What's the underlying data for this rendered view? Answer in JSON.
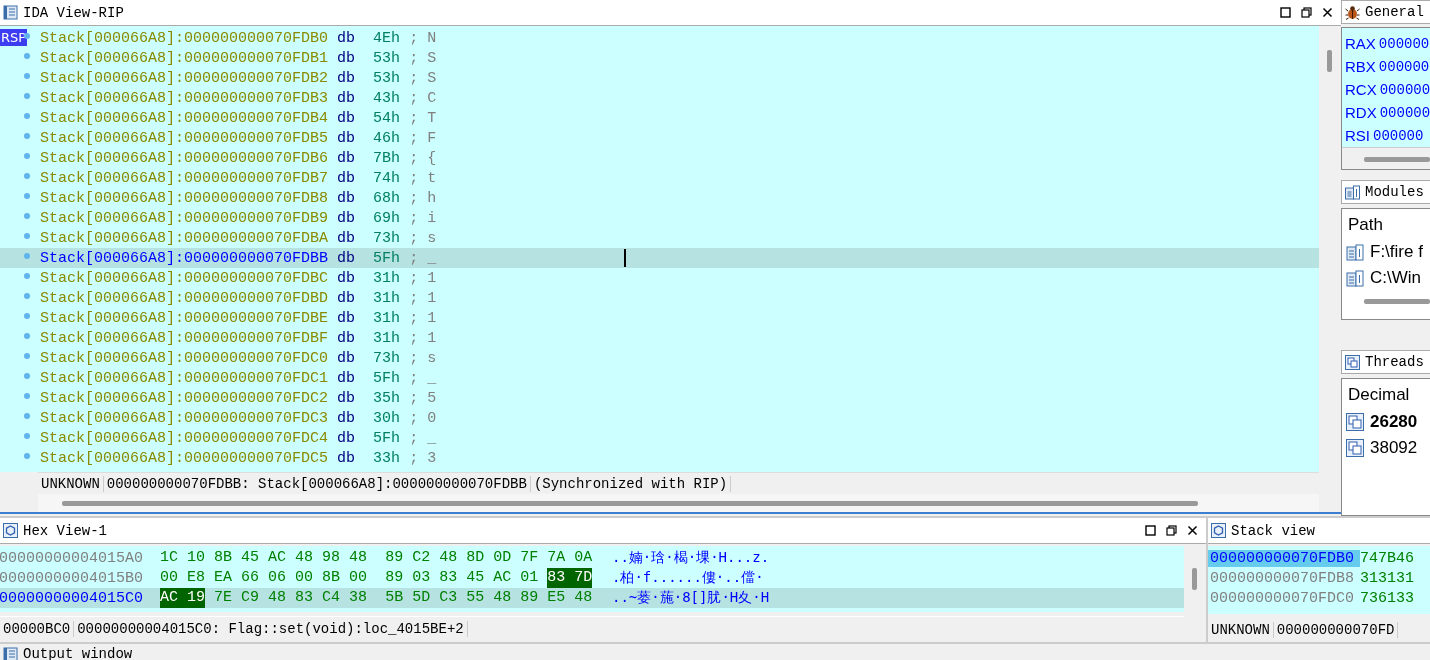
{
  "ida_view": {
    "title": "IDA View-RIP",
    "rows": [
      {
        "label": "RSP",
        "address": "Stack[000066A8]:000000000070FDB0",
        "directive": "db",
        "value": "4Eh",
        "comment": "; N",
        "selected": false
      },
      {
        "address": "Stack[000066A8]:000000000070FDB1",
        "directive": "db",
        "value": "53h",
        "comment": "; S",
        "selected": false
      },
      {
        "address": "Stack[000066A8]:000000000070FDB2",
        "directive": "db",
        "value": "53h",
        "comment": "; S",
        "selected": false
      },
      {
        "address": "Stack[000066A8]:000000000070FDB3",
        "directive": "db",
        "value": "43h",
        "comment": "; C",
        "selected": false
      },
      {
        "address": "Stack[000066A8]:000000000070FDB4",
        "directive": "db",
        "value": "54h",
        "comment": "; T",
        "selected": false
      },
      {
        "address": "Stack[000066A8]:000000000070FDB5",
        "directive": "db",
        "value": "46h",
        "comment": "; F",
        "selected": false
      },
      {
        "address": "Stack[000066A8]:000000000070FDB6",
        "directive": "db",
        "value": "7Bh",
        "comment": "; {",
        "selected": false
      },
      {
        "address": "Stack[000066A8]:000000000070FDB7",
        "directive": "db",
        "value": "74h",
        "comment": "; t",
        "selected": false
      },
      {
        "address": "Stack[000066A8]:000000000070FDB8",
        "directive": "db",
        "value": "68h",
        "comment": "; h",
        "selected": false
      },
      {
        "address": "Stack[000066A8]:000000000070FDB9",
        "directive": "db",
        "value": "69h",
        "comment": "; i",
        "selected": false
      },
      {
        "address": "Stack[000066A8]:000000000070FDBA",
        "directive": "db",
        "value": "73h",
        "comment": "; s",
        "selected": false
      },
      {
        "address": "Stack[000066A8]:000000000070FDBB",
        "directive": "db",
        "value": "5Fh",
        "comment": "; _",
        "selected": true
      },
      {
        "address": "Stack[000066A8]:000000000070FDBC",
        "directive": "db",
        "value": "31h",
        "comment": "; 1",
        "selected": false
      },
      {
        "address": "Stack[000066A8]:000000000070FDBD",
        "directive": "db",
        "value": "31h",
        "comment": "; 1",
        "selected": false
      },
      {
        "address": "Stack[000066A8]:000000000070FDBE",
        "directive": "db",
        "value": "31h",
        "comment": "; 1",
        "selected": false
      },
      {
        "address": "Stack[000066A8]:000000000070FDBF",
        "directive": "db",
        "value": "31h",
        "comment": "; 1",
        "selected": false
      },
      {
        "address": "Stack[000066A8]:000000000070FDC0",
        "directive": "db",
        "value": "73h",
        "comment": "; s",
        "selected": false
      },
      {
        "address": "Stack[000066A8]:000000000070FDC1",
        "directive": "db",
        "value": "5Fh",
        "comment": "; _",
        "selected": false
      },
      {
        "address": "Stack[000066A8]:000000000070FDC2",
        "directive": "db",
        "value": "35h",
        "comment": "; 5",
        "selected": false
      },
      {
        "address": "Stack[000066A8]:000000000070FDC3",
        "directive": "db",
        "value": "30h",
        "comment": "; 0",
        "selected": false
      },
      {
        "address": "Stack[000066A8]:000000000070FDC4",
        "directive": "db",
        "value": "5Fh",
        "comment": "; _",
        "selected": false
      },
      {
        "address": "Stack[000066A8]:000000000070FDC5",
        "directive": "db",
        "value": "33h",
        "comment": "; 3",
        "selected": false
      }
    ],
    "status": [
      "UNKNOWN",
      "000000000070FDBB: Stack[000066A8]:000000000070FDBB",
      "(Synchronized with RIP)"
    ]
  },
  "registers": {
    "title": "General",
    "rows": [
      {
        "name": "RAX",
        "value": "000000"
      },
      {
        "name": "RBX",
        "value": "000000"
      },
      {
        "name": "RCX",
        "value": "000000"
      },
      {
        "name": "RDX",
        "value": "000000"
      },
      {
        "name": "RSI",
        "value": "000000"
      }
    ]
  },
  "modules": {
    "title": "Modules",
    "column": "Path",
    "rows": [
      "F:\\fire f",
      "C:\\Win"
    ]
  },
  "threads": {
    "title": "Threads",
    "column": "Decimal",
    "rows": [
      {
        "id": "26280",
        "current": true
      },
      {
        "id": "38092",
        "current": false
      }
    ]
  },
  "hex_view": {
    "title": "Hex View-1",
    "rows": [
      {
        "address": "00000000004015A0",
        "selected": false,
        "text": "..婻·琀·楬·堁·H...z.",
        "bytes": [
          {
            "byte": "1C",
            "highlighted": false
          },
          {
            "byte": "10",
            "highlighted": false
          },
          {
            "byte": "8B",
            "highlighted": false
          },
          {
            "byte": "45",
            "highlighted": false
          },
          {
            "byte": "AC",
            "highlighted": false
          },
          {
            "byte": "48",
            "highlighted": false
          },
          {
            "byte": "98",
            "highlighted": false
          },
          {
            "byte": "48",
            "highlighted": false
          },
          {
            "byte": "89",
            "highlighted": false
          },
          {
            "byte": "C2",
            "highlighted": false
          },
          {
            "byte": "48",
            "highlighted": false
          },
          {
            "byte": "8D",
            "highlighted": false
          },
          {
            "byte": "0D",
            "highlighted": false
          },
          {
            "byte": "7F",
            "highlighted": false
          },
          {
            "byte": "7A",
            "highlighted": false
          },
          {
            "byte": "0A",
            "highlighted": false
          }
        ]
      },
      {
        "address": "00000000004015B0",
        "selected": false,
        "text": ".柏·f......僂·..儅·",
        "bytes": [
          {
            "byte": "00",
            "highlighted": false
          },
          {
            "byte": "E8",
            "highlighted": false
          },
          {
            "byte": "EA",
            "highlighted": false
          },
          {
            "byte": "66",
            "highlighted": false
          },
          {
            "byte": "06",
            "highlighted": false
          },
          {
            "byte": "00",
            "highlighted": false
          },
          {
            "byte": "8B",
            "highlighted": false
          },
          {
            "byte": "00",
            "highlighted": false
          },
          {
            "byte": "89",
            "highlighted": false
          },
          {
            "byte": "03",
            "highlighted": false
          },
          {
            "byte": "83",
            "highlighted": false
          },
          {
            "byte": "45",
            "highlighted": false
          },
          {
            "byte": "AC",
            "highlighted": false
          },
          {
            "byte": "01",
            "highlighted": false
          },
          {
            "byte": "83",
            "highlighted": true
          },
          {
            "byte": "7D",
            "highlighted": true
          }
        ]
      },
      {
        "address": "00000000004015C0",
        "selected": true,
        "text": "..~蒌·葹·8[]肬·H夊·H",
        "bytes": [
          {
            "byte": "AC",
            "highlighted": true
          },
          {
            "byte": "19",
            "highlighted": true
          },
          {
            "byte": "7E",
            "highlighted": false
          },
          {
            "byte": "C9",
            "highlighted": false
          },
          {
            "byte": "48",
            "highlighted": false
          },
          {
            "byte": "83",
            "highlighted": false
          },
          {
            "byte": "C4",
            "highlighted": false
          },
          {
            "byte": "38",
            "highlighted": false
          },
          {
            "byte": "5B",
            "highlighted": false
          },
          {
            "byte": "5D",
            "highlighted": false
          },
          {
            "byte": "C3",
            "highlighted": false
          },
          {
            "byte": "55",
            "highlighted": false
          },
          {
            "byte": "48",
            "highlighted": false
          },
          {
            "byte": "89",
            "highlighted": false
          },
          {
            "byte": "E5",
            "highlighted": false
          },
          {
            "byte": "48",
            "highlighted": false
          }
        ]
      }
    ],
    "status": [
      "00000BC0",
      "00000000004015C0: Flag::set(void):loc_4015BE+2"
    ]
  },
  "stack_view": {
    "title": "Stack view",
    "rows": [
      {
        "address": "000000000070FDB0",
        "value": "747B46",
        "selected": true
      },
      {
        "address": "000000000070FDB8",
        "value": "313131",
        "selected": false
      },
      {
        "address": "000000000070FDC0",
        "value": "736133",
        "selected": false
      }
    ],
    "status": [
      "UNKNOWN",
      "000000000070FD"
    ]
  },
  "output_window": {
    "title": "Output window"
  }
}
